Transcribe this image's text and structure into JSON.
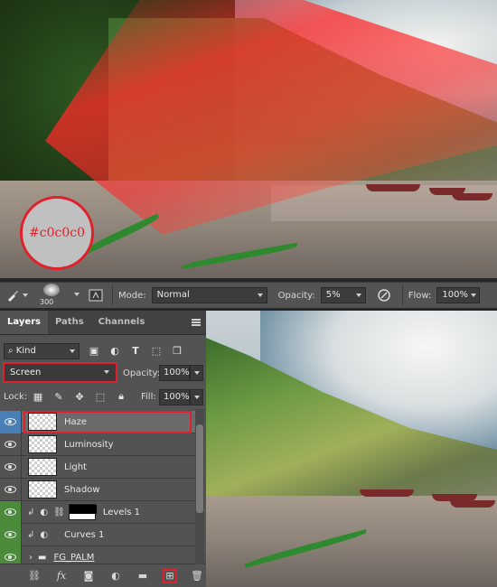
{
  "swatch": {
    "label": "#c0c0c0",
    "color": "#c0c0c0"
  },
  "options_bar": {
    "brush_size": "300",
    "mode_label": "Mode:",
    "mode_value": "Normal",
    "opacity_label": "Opacity:",
    "opacity_value": "5%",
    "flow_label": "Flow:",
    "flow_value": "100%"
  },
  "layers_panel": {
    "tabs": [
      {
        "label": "Layers",
        "active": true
      },
      {
        "label": "Paths",
        "active": false
      },
      {
        "label": "Channels",
        "active": false
      }
    ],
    "filter_kind": "Kind",
    "blend_mode": "Screen",
    "opacity_label": "Opacity:",
    "opacity_value": "100%",
    "lock_label": "Lock:",
    "fill_label": "Fill:",
    "fill_value": "100%",
    "layers": [
      {
        "name": "Haze",
        "selected": true
      },
      {
        "name": "Luminosity"
      },
      {
        "name": "Light"
      },
      {
        "name": "Shadow"
      },
      {
        "name": "Levels 1",
        "adjustment": true
      },
      {
        "name": "Curves 1",
        "adjustment": true
      },
      {
        "name": "FG_PALM",
        "group": true
      }
    ]
  },
  "colors": {
    "highlight": "#e0202a",
    "selected_eye": "#4a7fb6",
    "green_eye": "#4a8a3a"
  }
}
